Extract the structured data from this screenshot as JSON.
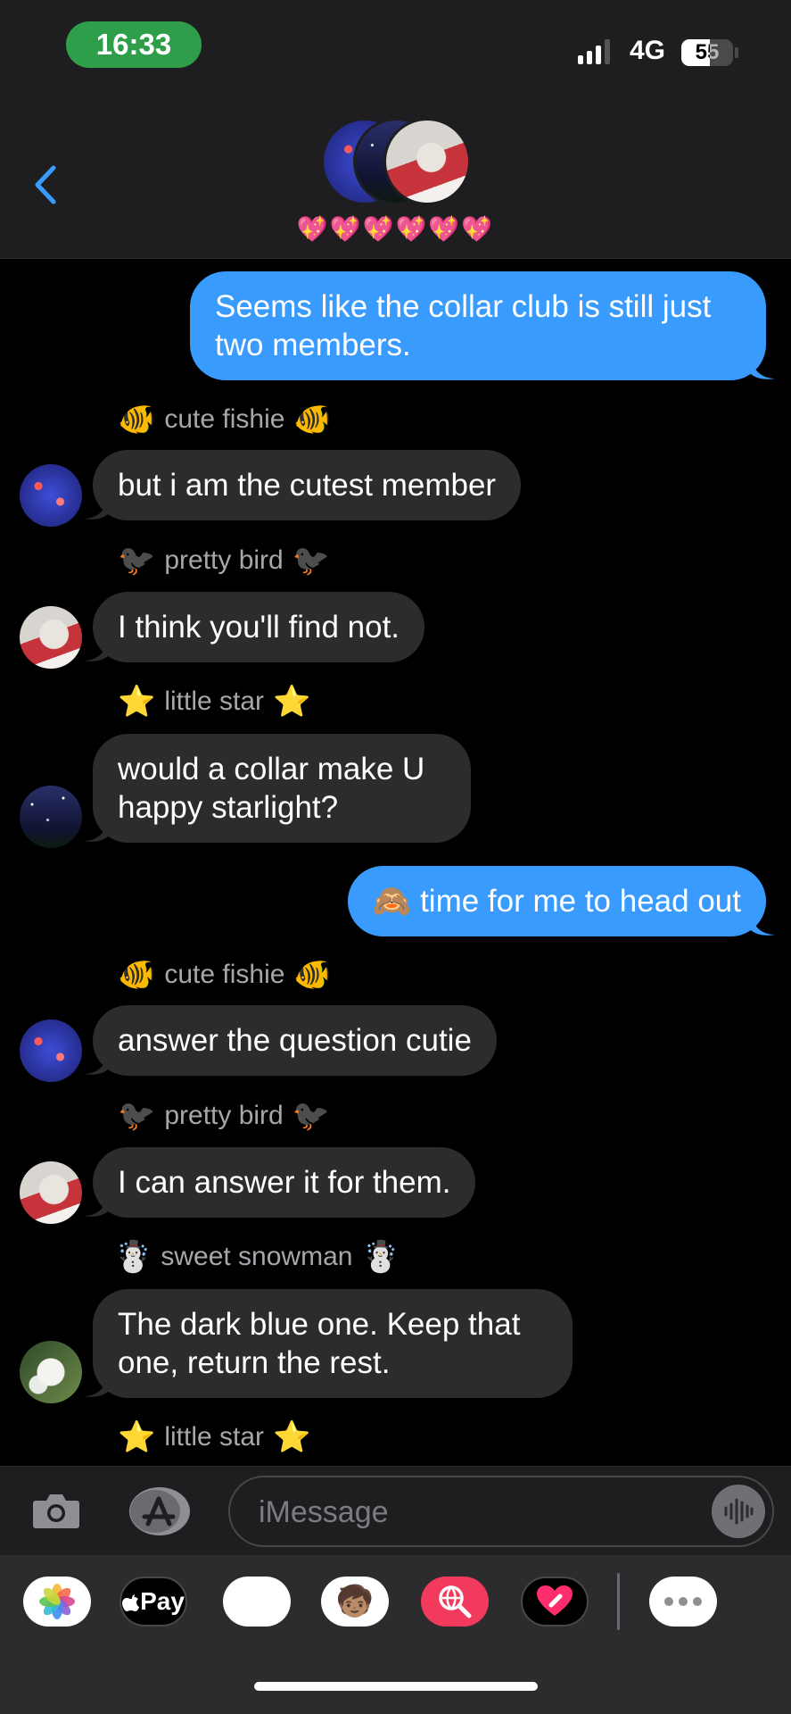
{
  "status_bar": {
    "time": "16:33",
    "network": "4G",
    "battery": "55"
  },
  "header": {
    "hearts": "💖💖💖💖💖💖"
  },
  "messages": [
    {
      "type": "out",
      "text": "Seems like the collar club is still just two members."
    },
    {
      "type": "sender",
      "emoji": "🐠",
      "name": "cute fishie"
    },
    {
      "type": "in",
      "text": "but i am the cutest member"
    },
    {
      "type": "sender",
      "emoji": "🐦‍⬛",
      "name": "pretty bird"
    },
    {
      "type": "in",
      "text": "I think you'll find not."
    },
    {
      "type": "sender",
      "emoji": "⭐",
      "name": "little star"
    },
    {
      "type": "in",
      "text": "would a collar make U happy starlight?"
    },
    {
      "type": "out",
      "emoji": "🙈",
      "text": "time for me to head out"
    },
    {
      "type": "sender",
      "emoji": "🐠",
      "name": "cute fishie"
    },
    {
      "type": "in",
      "text": "answer the question cutie"
    },
    {
      "type": "sender",
      "emoji": "🐦‍⬛",
      "name": "pretty bird"
    },
    {
      "type": "in",
      "text": "I can answer it for them."
    },
    {
      "type": "sender",
      "emoji": "☃️",
      "name": "sweet snowman"
    },
    {
      "type": "in",
      "text": "The dark blue one. Keep that one, return the rest."
    },
    {
      "type": "sender",
      "emoji": "⭐",
      "name": "little star"
    }
  ],
  "input": {
    "placeholder": "iMessage"
  },
  "app_strip": {
    "apple_pay_label": "Pay"
  },
  "colors": {
    "outgoing_bubble": "#3a9bff",
    "incoming_bubble": "#2c2c2e",
    "time_pill": "#2f9e4a"
  }
}
